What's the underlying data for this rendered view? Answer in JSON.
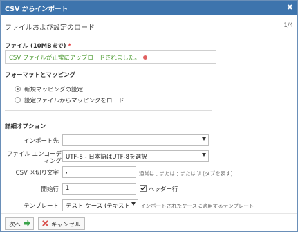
{
  "dialog": {
    "title": "CSV からインポート",
    "close_label": "✖",
    "step_title": "ファイルおよび設定のロード",
    "step_count": "1/4"
  },
  "file": {
    "label": "ファイル (10MBまで)",
    "required_mark": "*",
    "status": "CSV ファイルが正常にアップロードされました。"
  },
  "mapping": {
    "heading": "フォーマットとマッピング",
    "options": [
      {
        "label": "新規マッピングの設定",
        "selected": true
      },
      {
        "label": "設定ファイルからマッピングをロード",
        "selected": false
      }
    ]
  },
  "advanced": {
    "heading": "詳細オプション",
    "import_to_label": "インポート先",
    "import_to_value": "",
    "encoding_label": "ファイル エンコーディング",
    "encoding_value": "UTF-8 - 日本語はUTF-8を選択",
    "delimiter_label": "CSV 区切り文字",
    "delimiter_value": ",",
    "delimiter_hint": "通常は , または ; または \\t (タブを表す)",
    "start_row_label": "開始行",
    "start_row_value": "1",
    "header_row_label": "ヘッダー行",
    "header_row_checked": true,
    "template_label": "テンプレート",
    "template_value": "テスト ケース (テキスト",
    "template_hint": "インポートされたケースに適用するテンプレート"
  },
  "footer": {
    "next_label": "次へ",
    "cancel_label": "キャンセル"
  },
  "colors": {
    "titlebar": "#3d74ad",
    "success_text": "#4a9a2e",
    "next_arrow": "#3aa34a",
    "cancel_icon": "#d9534f"
  }
}
